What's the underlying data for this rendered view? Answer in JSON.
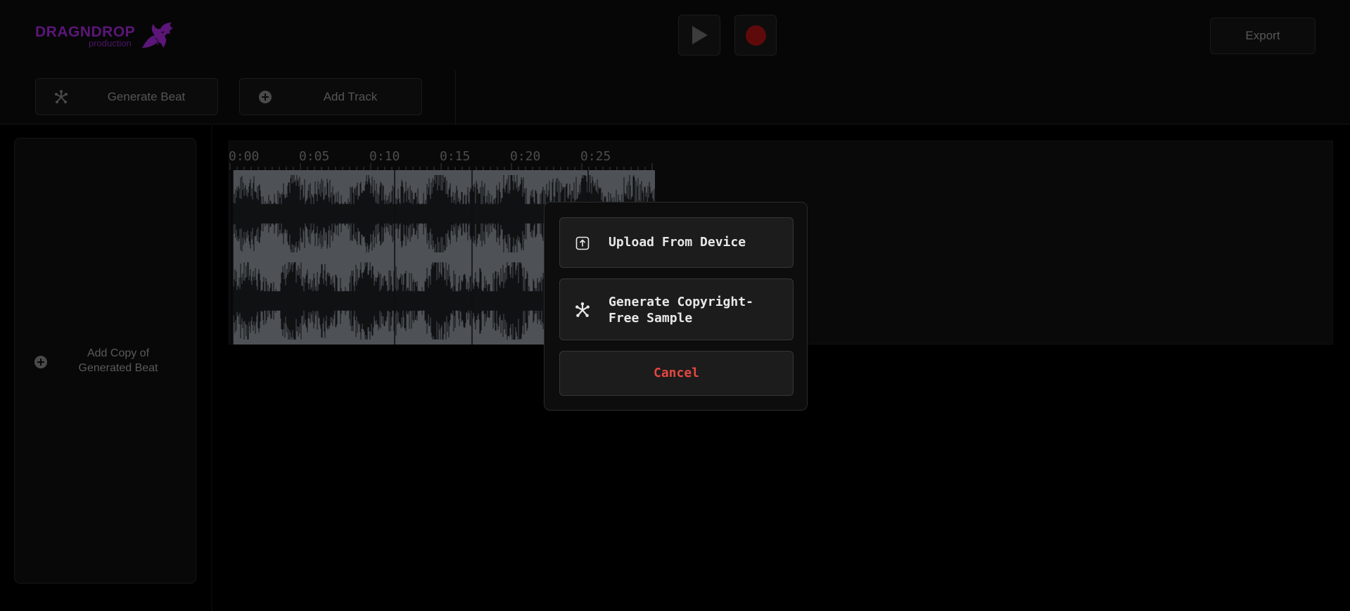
{
  "app": {
    "logo_text": "DRAGNDROP",
    "logo_subtext": "production",
    "brand_color": "#5b1678"
  },
  "transport": {
    "play_icon": "play-icon",
    "record_icon": "record-icon",
    "record_color": "#5e0a0a"
  },
  "header": {
    "export_label": "Export"
  },
  "toolbar": {
    "generate_beat_label": "Generate Beat",
    "generate_beat_icon": "sparkle-icon",
    "add_track_label": "Add Track",
    "add_track_icon": "plus-circle-icon"
  },
  "sidebar": {
    "add_copy_label_line1": "Add Copy of",
    "add_copy_label_line2": "Generated Beat",
    "add_copy_icon": "plus-circle-icon"
  },
  "timeline": {
    "tick_labels": [
      "0:00",
      "0:05",
      "0:10",
      "0:15",
      "0:20",
      "0:25"
    ]
  },
  "modal": {
    "upload_label": "Upload From Device",
    "upload_icon": "upload-icon",
    "generate_label_line1": "Generate Copyright-",
    "generate_label_line2": "Free Sample",
    "generate_icon": "sparkle-icon",
    "cancel_label": "Cancel",
    "cancel_color": "#e5473f"
  }
}
